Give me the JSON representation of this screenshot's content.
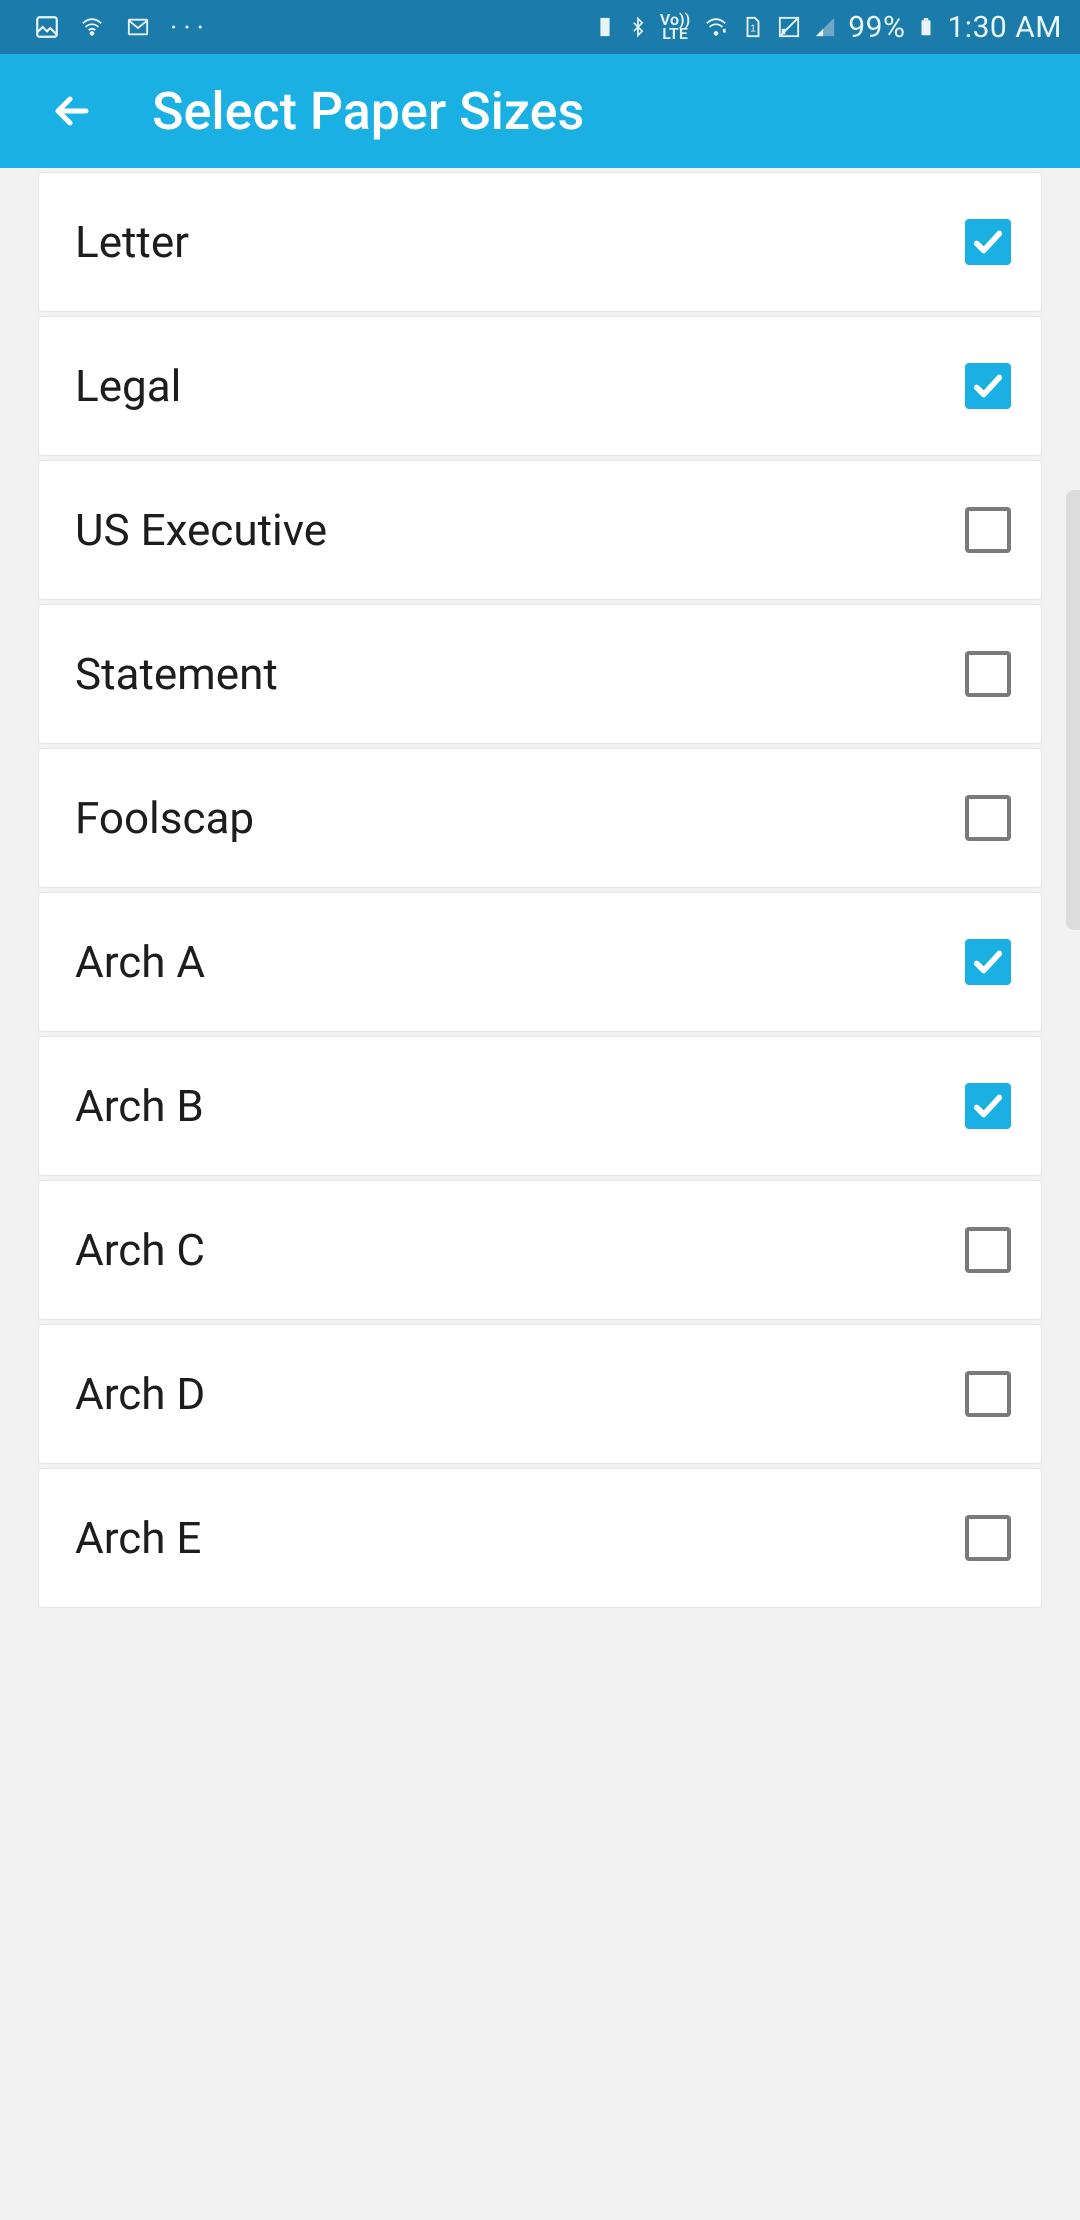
{
  "status": {
    "battery": "99%",
    "time": "1:30 AM"
  },
  "header": {
    "title": "Select Paper Sizes"
  },
  "items": [
    {
      "label": "Letter",
      "checked": true
    },
    {
      "label": "Legal",
      "checked": true
    },
    {
      "label": "US Executive",
      "checked": false
    },
    {
      "label": "Statement",
      "checked": false
    },
    {
      "label": "Foolscap",
      "checked": false
    },
    {
      "label": "Arch A",
      "checked": true
    },
    {
      "label": "Arch B",
      "checked": true
    },
    {
      "label": "Arch C",
      "checked": false
    },
    {
      "label": "Arch D",
      "checked": false
    },
    {
      "label": "Arch E",
      "checked": false
    }
  ]
}
